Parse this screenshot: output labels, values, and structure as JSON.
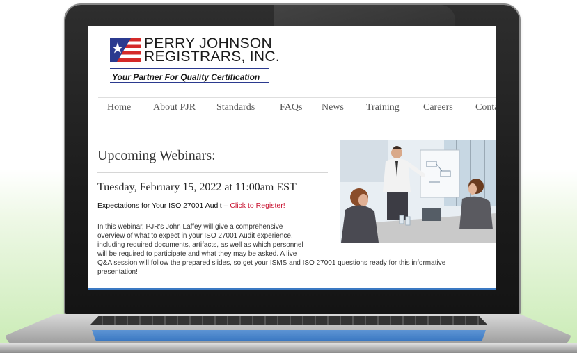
{
  "logo": {
    "line1": "PERRY JOHNSON",
    "line2": "REGISTRARS, INC.",
    "tagline": "Your Partner For Quality Certification"
  },
  "nav": {
    "items": [
      {
        "label": "Home"
      },
      {
        "label": "About PJR"
      },
      {
        "label": "Standards"
      },
      {
        "label": "FAQs"
      },
      {
        "label": "News"
      },
      {
        "label": "Training"
      },
      {
        "label": "Careers"
      },
      {
        "label": "Conta"
      }
    ]
  },
  "webinars": {
    "heading": "Upcoming Webinars:",
    "event": {
      "date": "Tuesday, February 15, 2022 at 11:00am EST",
      "title_prefix": "Expectations for Your ISO 27001 Audit – ",
      "register_link": "Click to Register!",
      "description_lines": [
        "In this webinar, PJR's John Laffey will give a comprehensive",
        "overview of what to expect in your ISO 27001 Audit experience,",
        "including required documents, artifacts, as well as which personnel",
        "will be required to participate and what they may be asked. A live",
        "Q&A session will follow the prepared slides, so get your ISMS and ISO 27001 questions ready for this informative",
        "presentation!"
      ]
    }
  },
  "colors": {
    "brand_blue": "#2b3a8f",
    "link_red": "#c8102e",
    "accent_blue": "#3a78c2"
  }
}
